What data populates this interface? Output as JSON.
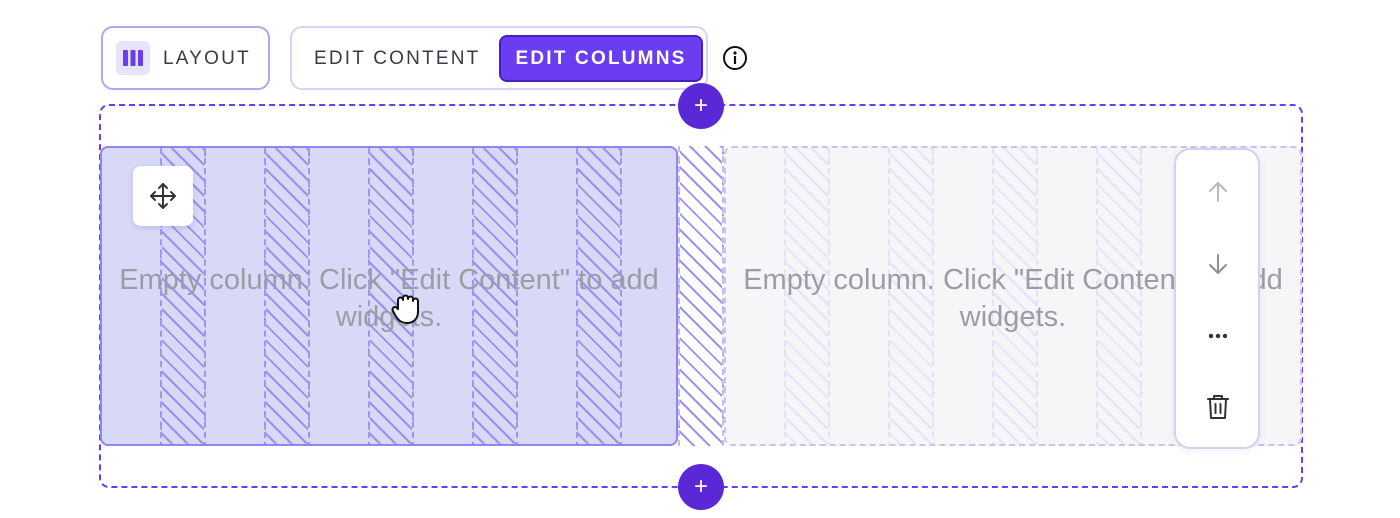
{
  "toolbar": {
    "layout_label": "LAYOUT",
    "layout_icon": "columns-icon",
    "edit_content_label": "EDIT CONTENT",
    "edit_columns_label": "EDIT COLUMNS",
    "active_mode": "EDIT COLUMNS",
    "info_icon": "info-icon"
  },
  "row": {
    "add_above_symbol": "+",
    "add_below_symbol": "+",
    "columns": [
      {
        "placeholder": "Empty column. Click \"Edit Content\" to add widgets.",
        "state": "selected"
      },
      {
        "placeholder": "Empty column. Click \"Edit Content\" to add widgets.",
        "state": "default"
      }
    ]
  },
  "column_actions": {
    "move_icon": "move-icon",
    "items": [
      "arrow-up-icon",
      "arrow-down-icon",
      "more-icon",
      "trash-icon"
    ]
  },
  "colors": {
    "accent": "#6b3df0",
    "accent_dark": "#5a28d6",
    "selected_column_bg": "#d7d9f7",
    "column_bg": "#f6f6f8",
    "placeholder_text": "#9c9ca6"
  }
}
